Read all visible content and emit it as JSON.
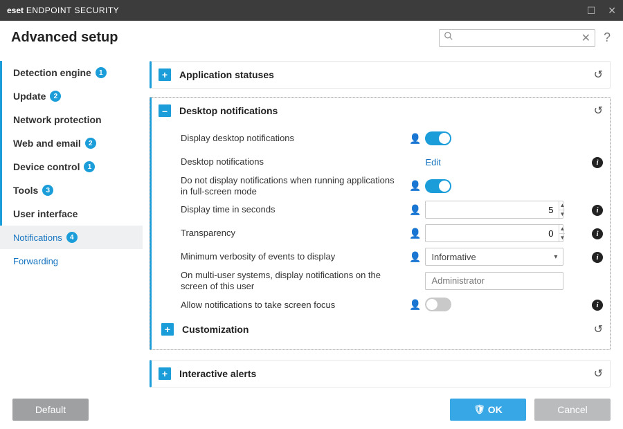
{
  "window": {
    "brand_prefix": "eset",
    "brand_suffix": "ENDPOINT SECURITY"
  },
  "header": {
    "title": "Advanced setup",
    "search_placeholder": ""
  },
  "sidebar": {
    "items": [
      {
        "label": "Detection engine",
        "badge": "1"
      },
      {
        "label": "Update",
        "badge": "2"
      },
      {
        "label": "Network protection",
        "badge": ""
      },
      {
        "label": "Web and email",
        "badge": "2"
      },
      {
        "label": "Device control",
        "badge": "1"
      },
      {
        "label": "Tools",
        "badge": "3"
      },
      {
        "label": "User interface",
        "badge": ""
      }
    ],
    "subs": [
      {
        "label": "Notifications",
        "badge": "4"
      },
      {
        "label": "Forwarding",
        "badge": ""
      }
    ]
  },
  "panels": {
    "app_statuses": {
      "title": "Application statuses"
    },
    "desktop": {
      "title": "Desktop notifications",
      "rows": {
        "display_desktop": {
          "label": "Display desktop notifications",
          "on": true
        },
        "desktop_notif": {
          "label": "Desktop notifications",
          "action": "Edit"
        },
        "fullscreen": {
          "label": "Do not display notifications when running applications in full-screen mode",
          "on": true
        },
        "display_time": {
          "label": "Display time in seconds",
          "value": "5"
        },
        "transparency": {
          "label": "Transparency",
          "value": "0"
        },
        "verbosity": {
          "label": "Minimum verbosity of events to display",
          "value": "Informative"
        },
        "multiuser": {
          "label": "On multi-user systems, display notifications on the screen of this user",
          "placeholder": "Administrator"
        },
        "focus": {
          "label": "Allow notifications to take screen focus",
          "on": false
        }
      },
      "customization": {
        "title": "Customization"
      }
    },
    "interactive": {
      "title": "Interactive alerts"
    }
  },
  "footer": {
    "default": "Default",
    "ok": "OK",
    "cancel": "Cancel"
  }
}
